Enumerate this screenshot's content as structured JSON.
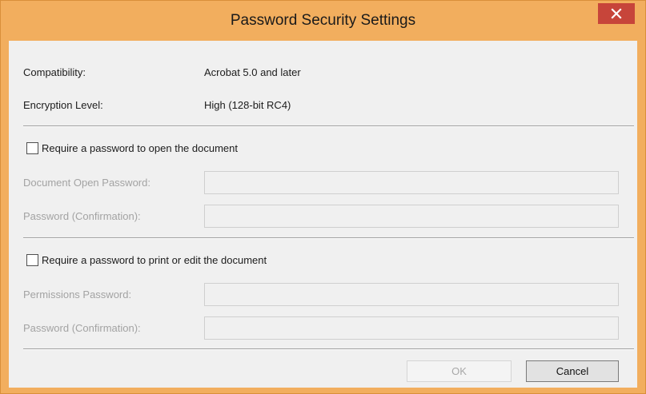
{
  "window": {
    "title": "Password Security Settings",
    "close_icon": "close-icon"
  },
  "info": {
    "compatibility_label": "Compatibility:",
    "compatibility_value": "Acrobat 5.0 and later",
    "encryption_label": "Encryption Level:",
    "encryption_value": "High (128-bit RC4)"
  },
  "open_section": {
    "checkbox_label": "Require a password to open the document",
    "checked": false,
    "password_label": "Document Open Password:",
    "password_value": "",
    "confirm_label": "Password (Confirmation):",
    "confirm_value": ""
  },
  "permissions_section": {
    "checkbox_label": "Require a password to print or edit the document",
    "checked": false,
    "password_label": "Permissions Password:",
    "password_value": "",
    "confirm_label": "Password (Confirmation):",
    "confirm_value": ""
  },
  "buttons": {
    "ok_label": "OK",
    "ok_enabled": false,
    "cancel_label": "Cancel"
  },
  "colors": {
    "title_bar": "#f2ae5e",
    "close_button": "#c7453a",
    "dialog_background": "#f0f0f0",
    "disabled_text": "#a3a3a3"
  }
}
